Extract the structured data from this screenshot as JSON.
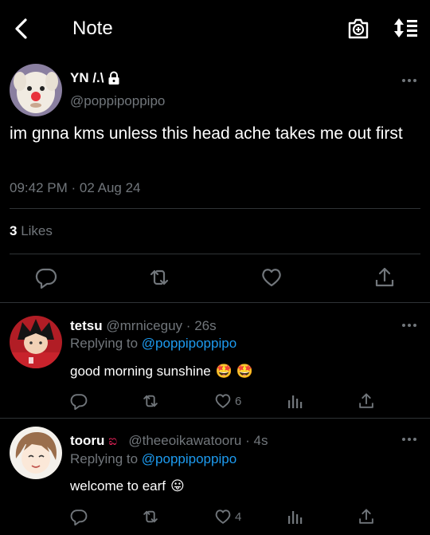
{
  "header": {
    "title": "Note"
  },
  "tweet": {
    "name": "YN /.\\",
    "handle": "@poppipoppipo",
    "text": "im gnna kms unless this head ache takes me out first",
    "time": "09:42 PM",
    "sep": "·",
    "date": "02 Aug 24",
    "likes_count": "3",
    "likes_label": "Likes"
  },
  "replies": [
    {
      "name": "tetsu",
      "handle": "@mrniceguy",
      "sep": "·",
      "age": "26s",
      "replying_label": "Replying to",
      "replying_to": "@poppipoppipo",
      "text": "good morning sunshine",
      "emoji": "🤩 🤩",
      "like_count": "6"
    },
    {
      "name": "tooru",
      "name_emoji": "ಐ",
      "handle": "@theeoikawatooru",
      "sep": "·",
      "age": "4s",
      "replying_label": "Replying to",
      "replying_to": "@poppipoppipo",
      "text": "welcome to earf",
      "emoji": "😛",
      "like_count": "4"
    }
  ],
  "colors": {
    "background": "#000000",
    "text": "#e7e9ea",
    "muted": "#71767b",
    "link": "#1d9bf0",
    "divider": "#2f3336"
  }
}
